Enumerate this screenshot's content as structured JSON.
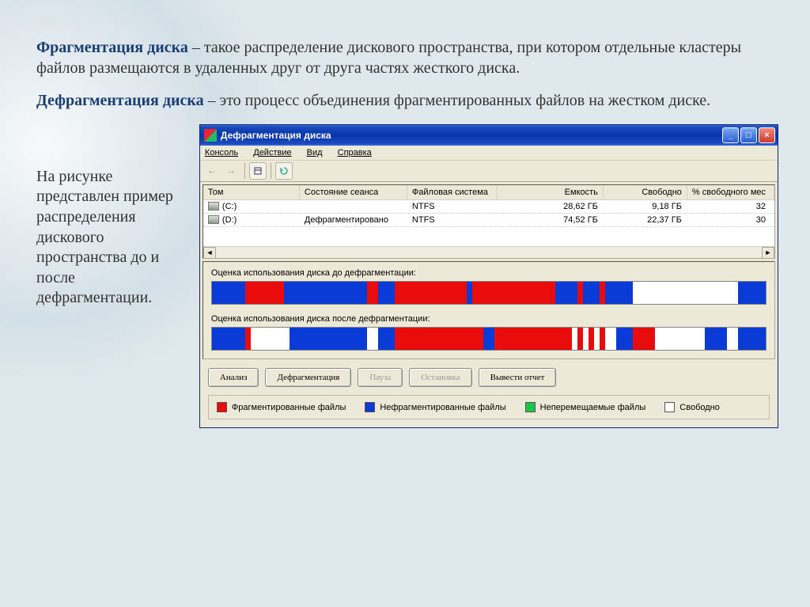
{
  "intro": {
    "term1": "Фрагментация диска",
    "text1": " – такое распределение дискового пространства, при котором отдельные кластеры файлов размещаются в удаленных друг от друга частях жесткого диска.",
    "term2": "Дефрагментация диска",
    "text2": " – это процесс объединения фрагментированных файлов на жестком диске."
  },
  "side_text": "На рисунке представлен пример распределения дискового пространства до и после дефрагментации.",
  "window": {
    "title": "Дефрагментация диска",
    "menu": {
      "console": "Консоль",
      "action": "Действие",
      "view": "Вид",
      "help": "Справка"
    },
    "columns": {
      "volume": "Том",
      "session": "Состояние сеанса",
      "fs": "Файловая система",
      "capacity": "Емкость",
      "free": "Свободно",
      "pct": "% свободного мес"
    },
    "rows": [
      {
        "volume": "(C:)",
        "session": "",
        "fs": "NTFS",
        "capacity": "28,62 ГБ",
        "free": "9,18 ГБ",
        "pct": "32"
      },
      {
        "volume": "(D:)",
        "session": "Дефрагментировано",
        "fs": "NTFS",
        "capacity": "74,52 ГБ",
        "free": "22,37 ГБ",
        "pct": "30"
      }
    ],
    "labels": {
      "before": "Оценка использования диска до дефрагментации:",
      "after": "Оценка использования диска после дефрагментации:"
    },
    "buttons": {
      "analyze": "Анализ",
      "defrag": "Дефрагментация",
      "pause": "Пауза",
      "stop": "Остановка",
      "report": "Вывести отчет"
    },
    "legend": {
      "frag": "Фрагментированные файлы",
      "nonfrag": "Нефрагментированные файлы",
      "unmov": "Неперемещаемые файлы",
      "free": "Свободно"
    }
  },
  "chart_data": [
    {
      "type": "bar",
      "title": "Оценка использования диска до дефрагментации",
      "categories": [
        "segment"
      ],
      "series": [
        {
          "name": "blue",
          "color": "#0b3bd6",
          "segments": [
            {
              "start": 0,
              "width": 6
            },
            {
              "start": 13,
              "width": 15
            },
            {
              "start": 30,
              "width": 3
            },
            {
              "start": 46,
              "width": 1
            },
            {
              "start": 62,
              "width": 14
            },
            {
              "start": 95,
              "width": 5
            }
          ]
        },
        {
          "name": "red",
          "color": "#e80c0c",
          "segments": [
            {
              "start": 6,
              "width": 7
            },
            {
              "start": 28,
              "width": 2
            },
            {
              "start": 33,
              "width": 13
            },
            {
              "start": 47,
              "width": 15
            },
            {
              "start": 66,
              "width": 1
            },
            {
              "start": 70,
              "width": 1
            }
          ]
        },
        {
          "name": "white",
          "color": "#ffffff",
          "segments": [
            {
              "start": 76,
              "width": 19
            }
          ]
        }
      ]
    },
    {
      "type": "bar",
      "title": "Оценка использования диска после дефрагментации",
      "categories": [
        "segment"
      ],
      "series": [
        {
          "name": "blue",
          "color": "#0b3bd6",
          "segments": [
            {
              "start": 0,
              "width": 6
            },
            {
              "start": 14,
              "width": 14
            },
            {
              "start": 30,
              "width": 3
            },
            {
              "start": 49,
              "width": 2
            },
            {
              "start": 73,
              "width": 3
            },
            {
              "start": 89,
              "width": 4
            },
            {
              "start": 95,
              "width": 5
            }
          ]
        },
        {
          "name": "red",
          "color": "#e80c0c",
          "segments": [
            {
              "start": 6,
              "width": 1
            },
            {
              "start": 33,
              "width": 16
            },
            {
              "start": 51,
              "width": 14
            },
            {
              "start": 66,
              "width": 1
            },
            {
              "start": 68,
              "width": 1
            },
            {
              "start": 70,
              "width": 1
            },
            {
              "start": 76,
              "width": 4
            }
          ]
        },
        {
          "name": "white",
          "color": "#ffffff",
          "segments": [
            {
              "start": 7,
              "width": 7
            },
            {
              "start": 28,
              "width": 2
            },
            {
              "start": 65,
              "width": 1
            },
            {
              "start": 67,
              "width": 1
            },
            {
              "start": 69,
              "width": 1
            },
            {
              "start": 71,
              "width": 2
            },
            {
              "start": 80,
              "width": 9
            },
            {
              "start": 93,
              "width": 2
            }
          ]
        }
      ]
    }
  ]
}
